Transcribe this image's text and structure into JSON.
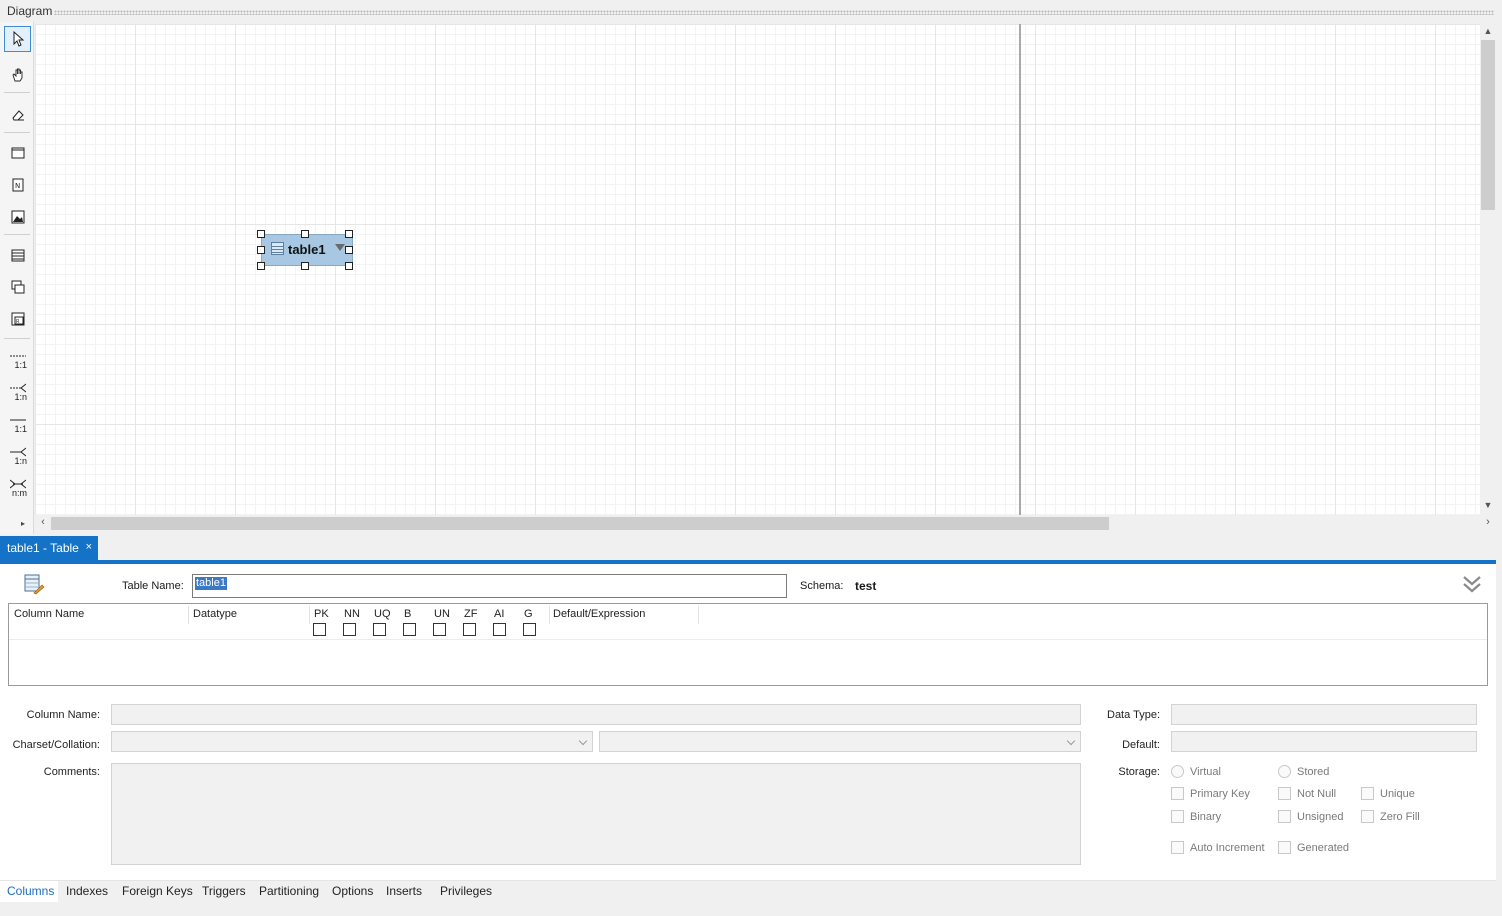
{
  "diagram": {
    "title": "Diagram"
  },
  "toolbox": {
    "rel_labels": [
      "1:1",
      "1:n",
      "1:1",
      "1:n",
      "n:m"
    ]
  },
  "canvas": {
    "table_figure": {
      "name": "table1"
    }
  },
  "editor_tab": {
    "label": "table1 - Table",
    "close": "×"
  },
  "editor": {
    "table_name_label": "Table Name:",
    "table_name_value": "table1",
    "schema_label": "Schema:",
    "schema_value": "test",
    "grid_headers": [
      "Column Name",
      "Datatype",
      "PK",
      "NN",
      "UQ",
      "B",
      "UN",
      "ZF",
      "AI",
      "G",
      "Default/Expression"
    ],
    "fields": {
      "column_name_label": "Column Name:",
      "charset_label": "Charset/Collation:",
      "comments_label": "Comments:",
      "data_type_label": "Data Type:",
      "default_label": "Default:",
      "storage_label": "Storage:"
    },
    "storage_options": [
      "Virtual",
      "Stored"
    ],
    "flags": [
      "Primary Key",
      "Not Null",
      "Unique",
      "Binary",
      "Unsigned",
      "Zero Fill",
      "Auto Increment",
      "Generated"
    ]
  },
  "bottom_tabs": [
    "Columns",
    "Indexes",
    "Foreign Keys",
    "Triggers",
    "Partitioning",
    "Options",
    "Inserts",
    "Privileges"
  ],
  "colors": {
    "accent": "#1473c6",
    "table_fill": "#a7c7e3"
  }
}
